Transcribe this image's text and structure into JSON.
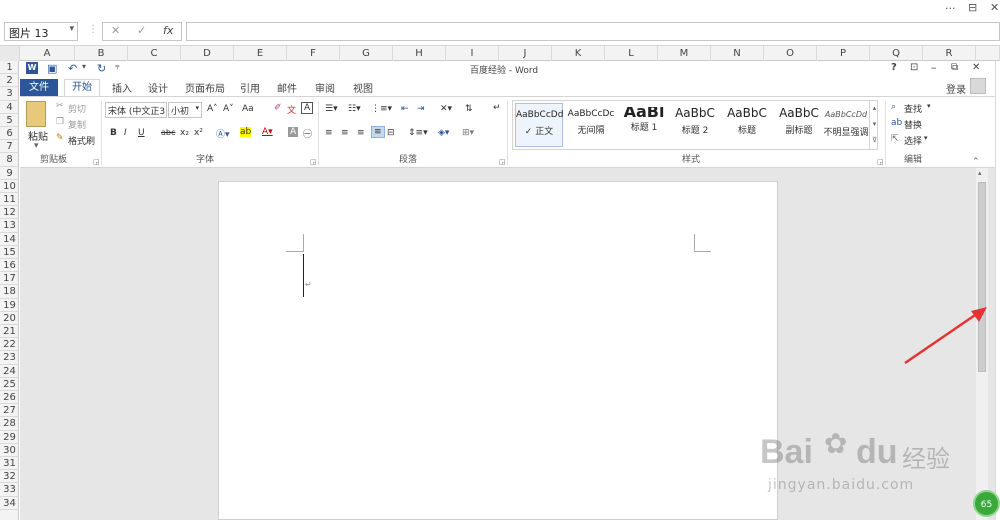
{
  "excel": {
    "window_controls": {
      "more": "···",
      "restore": "⊟",
      "close": "✕"
    },
    "name_box": "图片 13",
    "formula_buttons": {
      "cancel": "✕",
      "enter": "✓",
      "fx": "fx"
    },
    "columns": [
      "A",
      "B",
      "C",
      "D",
      "E",
      "F",
      "G",
      "H",
      "I",
      "J",
      "K",
      "L",
      "M",
      "N",
      "O",
      "P",
      "Q",
      "R"
    ],
    "rows": [
      "1",
      "2",
      "3",
      "4",
      "5",
      "6",
      "7",
      "8",
      "9",
      "10",
      "11",
      "12",
      "13",
      "14",
      "15",
      "16",
      "17",
      "18",
      "19",
      "20",
      "21",
      "22",
      "23",
      "24",
      "25",
      "26",
      "27",
      "28",
      "29",
      "30",
      "31",
      "32",
      "33",
      "34"
    ]
  },
  "word": {
    "title": "百度经验 - Word",
    "title_controls": {
      "help": "?",
      "ribbon_display": "⊡",
      "minimize": "–",
      "restore": "⧉",
      "close": "✕"
    },
    "login": "登录",
    "tabs": [
      "文件",
      "开始",
      "插入",
      "设计",
      "页面布局",
      "引用",
      "邮件",
      "审阅",
      "视图"
    ],
    "active_tab": "开始",
    "clipboard": {
      "paste": "粘贴",
      "cut": "剪切",
      "copy": "复制",
      "format_painter": "格式刷",
      "group": "剪贴板"
    },
    "font": {
      "name": "宋体 (中文正3",
      "size": "小初",
      "case": "Aa",
      "bold": "B",
      "italic": "I",
      "underline": "U",
      "strike": "abc",
      "sub": "x₂",
      "sup": "x²",
      "group": "字体"
    },
    "paragraph": {
      "group": "段落"
    },
    "styles": {
      "items": [
        {
          "preview": "AaBbCcDd",
          "name": "✓ 正文"
        },
        {
          "preview": "AaBbCcDc",
          "name": "无间隔"
        },
        {
          "preview": "AaBl",
          "name": "标题 1"
        },
        {
          "preview": "AaBbC",
          "name": "标题 2"
        },
        {
          "preview": "AaBbC",
          "name": "标题"
        },
        {
          "preview": "AaBbC",
          "name": "副标题"
        },
        {
          "preview": "AaBbCcDd",
          "name": "不明显强调"
        }
      ],
      "group": "样式"
    },
    "editing": {
      "find": "查找",
      "replace": "替换",
      "select": "选择",
      "group": "编辑"
    }
  },
  "watermark": {
    "brand": "Bai",
    "brand2": "du",
    "text": "经验",
    "url": "jingyan.baidu.com"
  },
  "badge": "65"
}
